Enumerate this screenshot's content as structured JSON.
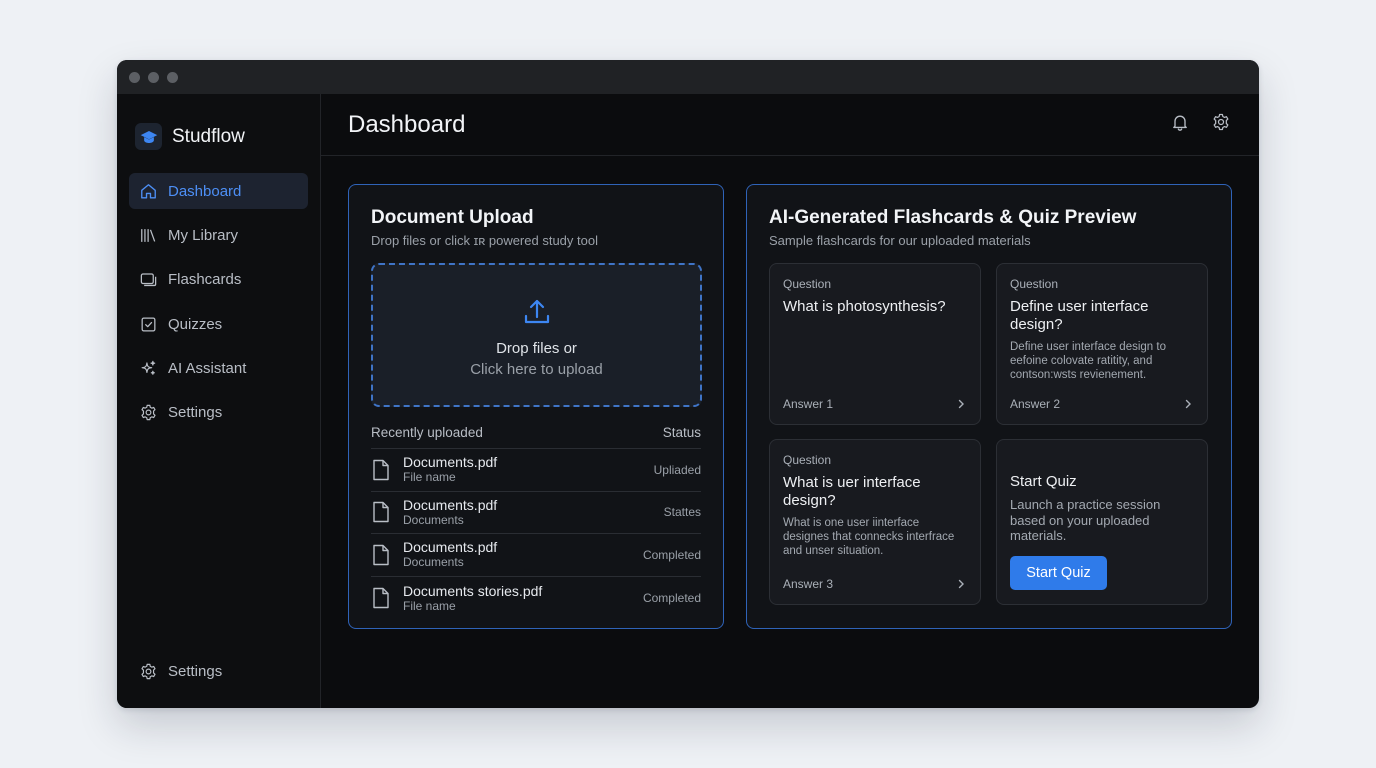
{
  "app": {
    "name": "Studflow"
  },
  "sidebar": {
    "items": [
      {
        "label": "Dashboard",
        "icon": "home-icon",
        "active": true
      },
      {
        "label": "My Library",
        "icon": "library-icon"
      },
      {
        "label": "Flashcards",
        "icon": "flashcards-icon"
      },
      {
        "label": "Quizzes",
        "icon": "checkbox-icon"
      },
      {
        "label": "AI Assistant",
        "icon": "sparkle-icon"
      },
      {
        "label": "Settings",
        "icon": "gear-icon"
      }
    ],
    "bottom_item": {
      "label": "Settings",
      "icon": "gear-icon"
    }
  },
  "header": {
    "title": "Dashboard"
  },
  "upload": {
    "title": "Document Upload",
    "subtitle": "Drop files or click ɪʀ powered study tool",
    "dropzone": {
      "line1": "Drop files or",
      "line2": "Click here to upload"
    },
    "list_header": {
      "left": "Recently uploaded",
      "right": "Status"
    },
    "files": [
      {
        "name": "Documents.pdf",
        "sub": "File name",
        "status": "Upliaded"
      },
      {
        "name": "Documents.pdf",
        "sub": "Documents",
        "status": "Stattes"
      },
      {
        "name": "Documents.pdf",
        "sub": "Documents",
        "status": "Completed"
      },
      {
        "name": "Documents stories.pdf",
        "sub": "File name",
        "status": "Completed"
      }
    ]
  },
  "flashcards": {
    "title": "AI-Generated Flashcards & Quiz Preview",
    "subtitle": "Sample flashcards for our uploaded materials",
    "cards": [
      {
        "label": "Question",
        "question": "What is photosynthesis?",
        "answer_text": "",
        "answer": "Answer 1"
      },
      {
        "label": "Question",
        "question": "Define user interface design?",
        "answer_text": "Define user interface design to eefoine colovate ratitity, and contson:wsts revienement.",
        "answer": "Answer 2"
      },
      {
        "label": "Question",
        "question": "What is uer interface design?",
        "answer_text": "What is one user iinterface designes that connecks interfrace and unser situation.",
        "answer": "Answer 3"
      }
    ],
    "quiz": {
      "title": "Start Quiz",
      "description": "Launch a practice session based on your uploaded materials.",
      "button": "Start Quiz"
    }
  },
  "colors": {
    "accent": "#2f7bea",
    "panel_border": "#2f63b8",
    "background": "#0b0c0e"
  }
}
